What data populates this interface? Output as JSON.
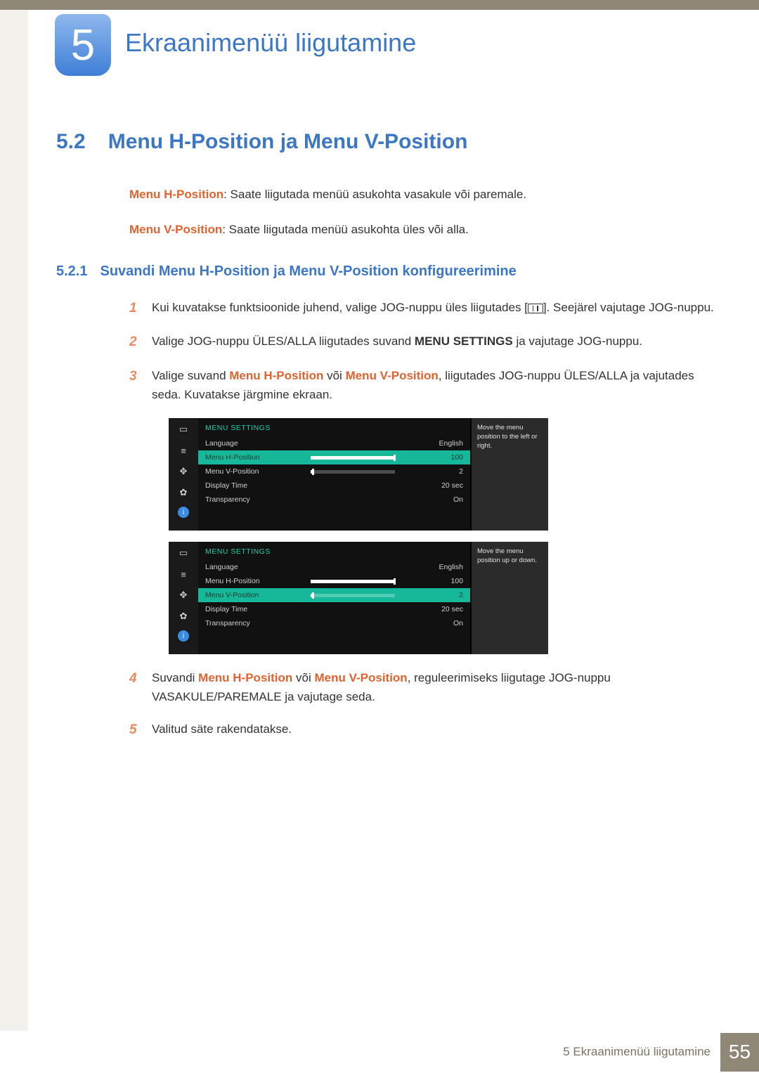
{
  "chapter": {
    "number": "5",
    "title": "Ekraanimenüü liigutamine"
  },
  "section": {
    "number": "5.2",
    "title": "Menu H-Position ja Menu V-Position",
    "para1_term": "Menu H-Position",
    "para1_rest": ": Saate liigutada menüü asukohta vasakule või paremale.",
    "para2_term": "Menu V-Position",
    "para2_rest": ": Saate liigutada menüü asukohta üles või alla."
  },
  "subsection": {
    "number": "5.2.1",
    "title": "Suvandi Menu H-Position ja Menu V-Position konfigureerimine"
  },
  "steps": {
    "s1a": "Kui kuvatakse funktsioonide juhend, valige JOG-nuppu üles liigutades [",
    "s1b": "]. Seejärel vajutage JOG-nuppu.",
    "s2a": "Valige JOG-nuppu ÜLES/ALLA liigutades suvand ",
    "s2b": "MENU SETTINGS",
    "s2c": " ja vajutage JOG-nuppu.",
    "s3a": "Valige suvand ",
    "s3b": "Menu H-Position",
    "s3c": " või ",
    "s3d": "Menu V-Position",
    "s3e": ", liigutades JOG-nuppu ÜLES/ALLA ja vajutades seda. Kuvatakse järgmine ekraan.",
    "s4a": "Suvandi ",
    "s4b": "Menu H-Position",
    "s4c": " või ",
    "s4d": "Menu V-Position",
    "s4e": ", reguleerimiseks liigutage JOG-nuppu VASAKULE/PAREMALE ja vajutage seda.",
    "s5": "Valitud säte rakendatakse."
  },
  "osd": {
    "title": "MENU SETTINGS",
    "rows": {
      "language": {
        "label": "Language",
        "value": "English"
      },
      "hpos": {
        "label": "Menu H-Position",
        "value": "100"
      },
      "vpos": {
        "label": "Menu V-Position",
        "value": "2"
      },
      "dtime": {
        "label": "Display Time",
        "value": "20 sec"
      },
      "transp": {
        "label": "Transparency",
        "value": "On"
      }
    },
    "desc1": "Move the menu position to the left or right.",
    "desc2": "Move the menu position up or down."
  },
  "footer": {
    "text": "5 Ekraanimenüü liigutamine",
    "page": "55"
  }
}
